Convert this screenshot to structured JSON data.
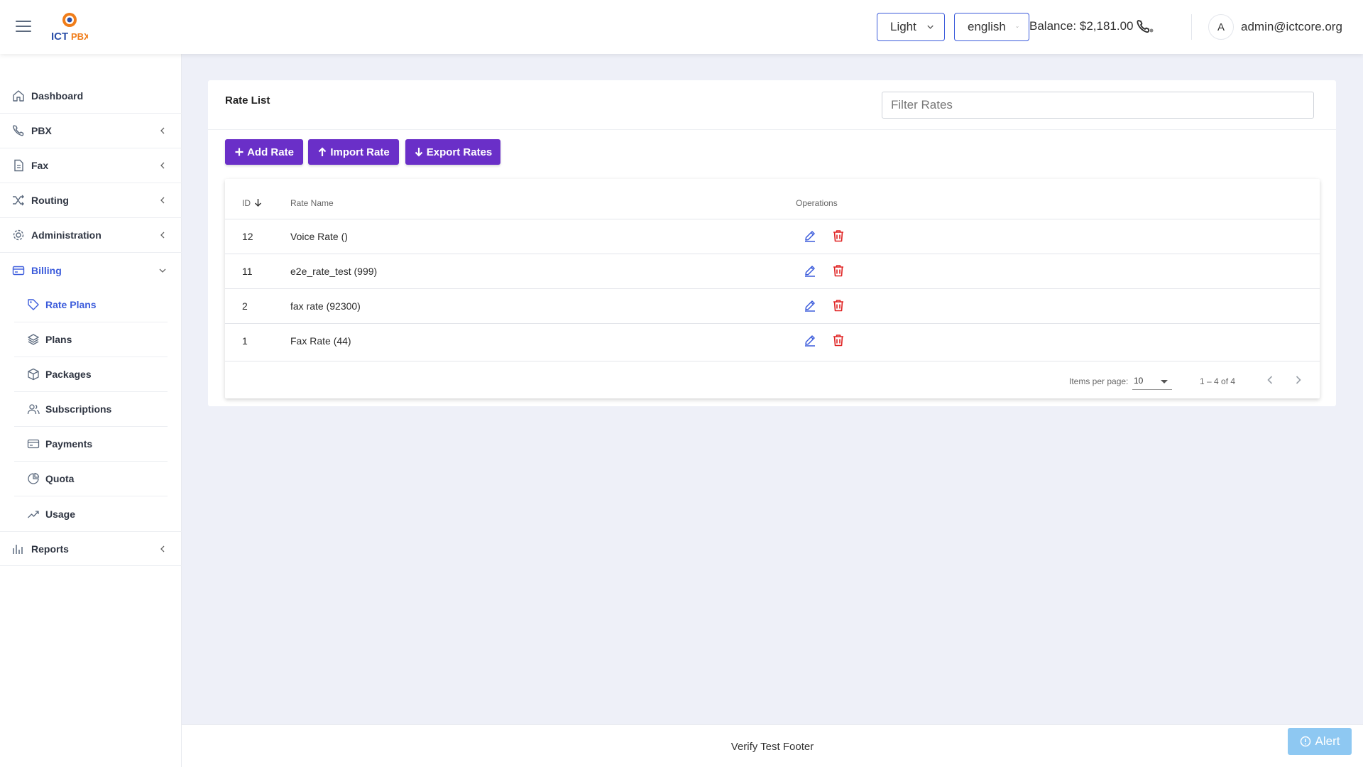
{
  "header": {
    "theme_select": "Light",
    "language_select": "english",
    "balance": "Balance: $2,181.00",
    "avatar_letter": "A",
    "user_email": "admin@ictcore.org"
  },
  "sidebar": {
    "items": [
      {
        "label": "Dashboard",
        "icon": "home-icon"
      },
      {
        "label": "PBX",
        "icon": "phone-icon"
      },
      {
        "label": "Fax",
        "icon": "file-icon"
      },
      {
        "label": "Routing",
        "icon": "shuffle-icon"
      },
      {
        "label": "Administration",
        "icon": "gear-icon"
      },
      {
        "label": "Billing",
        "icon": "credit-card-icon"
      },
      {
        "label": "Reports",
        "icon": "bar-chart-icon"
      }
    ],
    "billing_subitems": [
      {
        "label": "Rate Plans",
        "icon": "tag-icon"
      },
      {
        "label": "Plans",
        "icon": "layers-icon"
      },
      {
        "label": "Packages",
        "icon": "box-icon"
      },
      {
        "label": "Subscriptions",
        "icon": "users-icon"
      },
      {
        "label": "Payments",
        "icon": "payment-card-icon"
      },
      {
        "label": "Quota",
        "icon": "pie-icon"
      },
      {
        "label": "Usage",
        "icon": "trend-icon"
      }
    ]
  },
  "main": {
    "title": "Rate List",
    "filter_placeholder": "Filter Rates",
    "buttons": {
      "add": "Add Rate",
      "import": "Import Rate",
      "export": "Export Rates"
    },
    "table": {
      "columns": [
        "ID",
        "Rate Name",
        "Operations"
      ],
      "rows": [
        {
          "id": "12",
          "name": "Voice Rate ()"
        },
        {
          "id": "11",
          "name": "e2e_rate_test (999)"
        },
        {
          "id": "2",
          "name": "fax rate (92300)"
        },
        {
          "id": "1",
          "name": "Fax Rate (44)"
        }
      ]
    },
    "paginator": {
      "items_per_page_label": "Items per page:",
      "items_per_page": "10",
      "range": "1 – 4 of 4"
    }
  },
  "footer": {
    "text": "Verify Test Footer"
  },
  "alert_button": "Alert",
  "colors": {
    "accent": "#3b5bdb",
    "button": "#6a2fc8",
    "delete": "#e02424",
    "alert": "#8ec8f2"
  }
}
